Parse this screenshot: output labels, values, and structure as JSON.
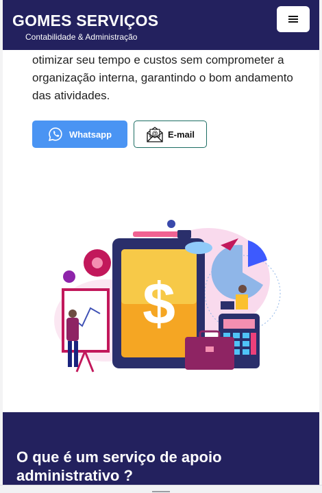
{
  "header": {
    "brand_title": "GOMES SERVIÇOS",
    "brand_subtitle": "Contabilidade & Administração",
    "menu_icon": "hamburger-icon",
    "bg_color": "#23215e"
  },
  "intro": {
    "text": "otimizar seu tempo e custos sem comprometer a organização interna, garantindo o bom andamento das atividades."
  },
  "contact": {
    "whatsapp_label": "Whatsapp",
    "whatsapp_icon": "whatsapp-icon",
    "whatsapp_color": "#4a94f3",
    "email_label": "E-mail",
    "email_icon": "email-icon",
    "email_border_color": "#1b6c62"
  },
  "illustration": {
    "name": "finance-illustration"
  },
  "section": {
    "title": "O que é um serviço de apoio administrativo ?"
  }
}
